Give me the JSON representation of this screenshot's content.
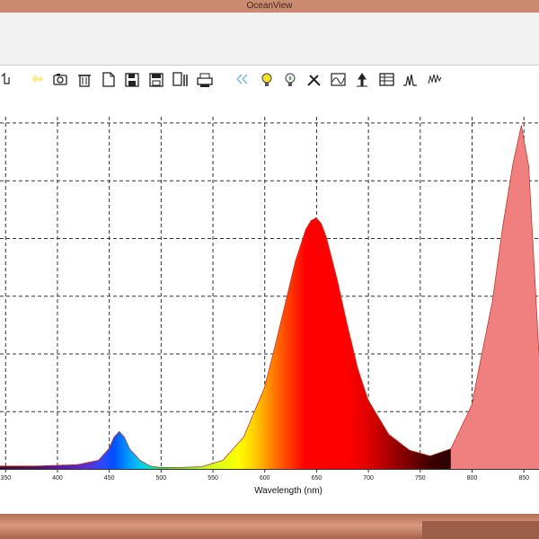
{
  "window": {
    "title": "OceanView"
  },
  "toolbar": {
    "icons": [
      "hand-icon",
      "arrow-icon",
      "camera-icon",
      "trash-icon",
      "document-icon",
      "save-icon",
      "save-all-icon",
      "copy-icon",
      "print-icon",
      "arrows-icon",
      "bulb-icon",
      "bulb-dark-icon",
      "tools-icon",
      "spectrum-icon",
      "peak-icon",
      "table-icon",
      "graph-icon",
      "noise-icon"
    ]
  },
  "chart_data": {
    "type": "area",
    "xlabel": "Wavelength (nm)",
    "ylabel": "",
    "xlim": [
      345,
      865
    ],
    "ylim": [
      0,
      1.22
    ],
    "x_ticks": [
      350,
      400,
      450,
      500,
      550,
      600,
      650,
      700,
      750,
      800,
      850
    ],
    "grid": true,
    "colors": {
      "border_line": "#c0392b",
      "grid": "#333333",
      "ir_fill": "#f08080"
    },
    "series": [
      {
        "x": [
          345,
          380,
          420,
          440,
          450,
          455,
          460,
          465,
          470,
          480,
          490,
          500,
          520,
          540,
          560,
          580,
          600,
          610,
          620,
          630,
          640,
          645,
          650,
          655,
          660,
          670,
          680,
          690,
          700,
          720,
          740,
          760,
          780,
          800,
          820,
          830,
          840,
          848,
          855,
          865
        ],
        "y": [
          0.01,
          0.01,
          0.015,
          0.03,
          0.07,
          0.11,
          0.13,
          0.11,
          0.07,
          0.03,
          0.01,
          0.005,
          0.005,
          0.008,
          0.03,
          0.11,
          0.28,
          0.42,
          0.57,
          0.72,
          0.83,
          0.86,
          0.87,
          0.85,
          0.8,
          0.66,
          0.5,
          0.35,
          0.24,
          0.12,
          0.065,
          0.045,
          0.07,
          0.22,
          0.58,
          0.84,
          1.06,
          1.19,
          1.05,
          0.4
        ]
      }
    ]
  }
}
